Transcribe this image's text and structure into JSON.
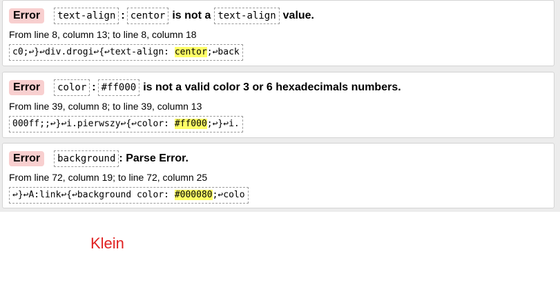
{
  "errors": [
    {
      "badge": "Error",
      "property": "text-align",
      "sep": ":",
      "value": "centor",
      "message_mid": "is not a",
      "property_ref": "text-align",
      "message_end": "value.",
      "location": "From line 8, column 13; to line 8, column 18",
      "context_before": "c0;↩}↩div.drogi↩{↩text-align: ",
      "context_highlight": "centor",
      "context_after": ";↩back"
    },
    {
      "badge": "Error",
      "property": "color",
      "sep": ":",
      "value": "#ff000",
      "message": "is not a valid color 3 or 6 hexadecimals numbers.",
      "location": "From line 39, column 8; to line 39, column 13",
      "context_before": "000ff;;↩}↩i.pierwszy↩{↩color: ",
      "context_highlight": "#ff000",
      "context_after": ";↩}↩i."
    },
    {
      "badge": "Error",
      "property": "background",
      "message": ": Parse Error.",
      "location": "From line 72, column 19; to line 72, column 25",
      "context_before": "↩}↩A:link↩{↩background color: ",
      "context_highlight": "#000080",
      "context_after": ";↩colo"
    }
  ],
  "footer": {
    "label": "Klein",
    "color": "#e02020"
  },
  "colors": {
    "badge_bg": "#f8cfcf",
    "highlight": "#ffff66"
  }
}
